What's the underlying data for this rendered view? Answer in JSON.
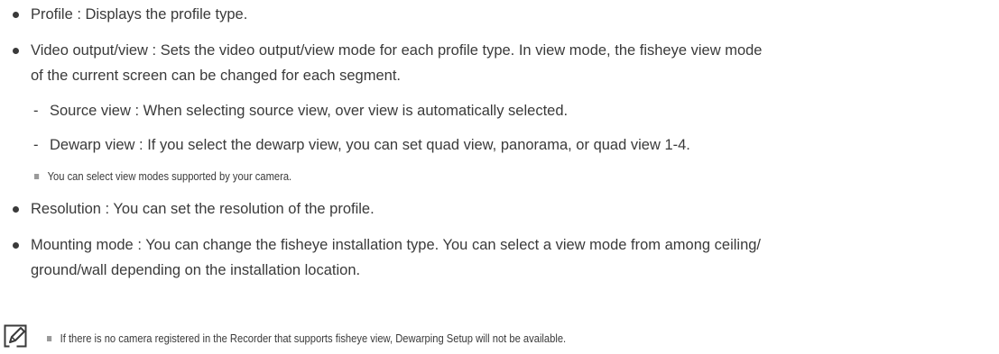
{
  "bullets": {
    "profile": "Profile : Displays the profile type.",
    "video_output_line1": "Video output/view : Sets the video output/view mode for each profile type. In view mode, the fisheye view mode",
    "video_output_line2": "of the current screen can be changed for each segment.",
    "resolution": "Resolution : You can set the resolution of the profile.",
    "mounting_line1": "Mounting mode : You can change the fisheye installation type. You can select a view mode from among ceiling/",
    "mounting_line2": "ground/wall depending on the installation location."
  },
  "sub_items": {
    "source_view": "Source view : When selecting source view, over view is automatically selected.",
    "dewarp_view": "Dewarp view : If you select the dewarp view, you can set quad view, panorama, or quad view 1-4."
  },
  "notes": {
    "view_modes": "You can select view modes supported by your camera.",
    "fisheye_note": "If there is no camera registered in the Recorder that supports fisheye view, Dewarping Setup will not be available."
  },
  "marks": {
    "dash": "-"
  },
  "icons": {
    "note": "note-pencil-icon"
  },
  "colors": {
    "text": "#3a3a3a",
    "square_bullet": "#9a9a9a"
  }
}
